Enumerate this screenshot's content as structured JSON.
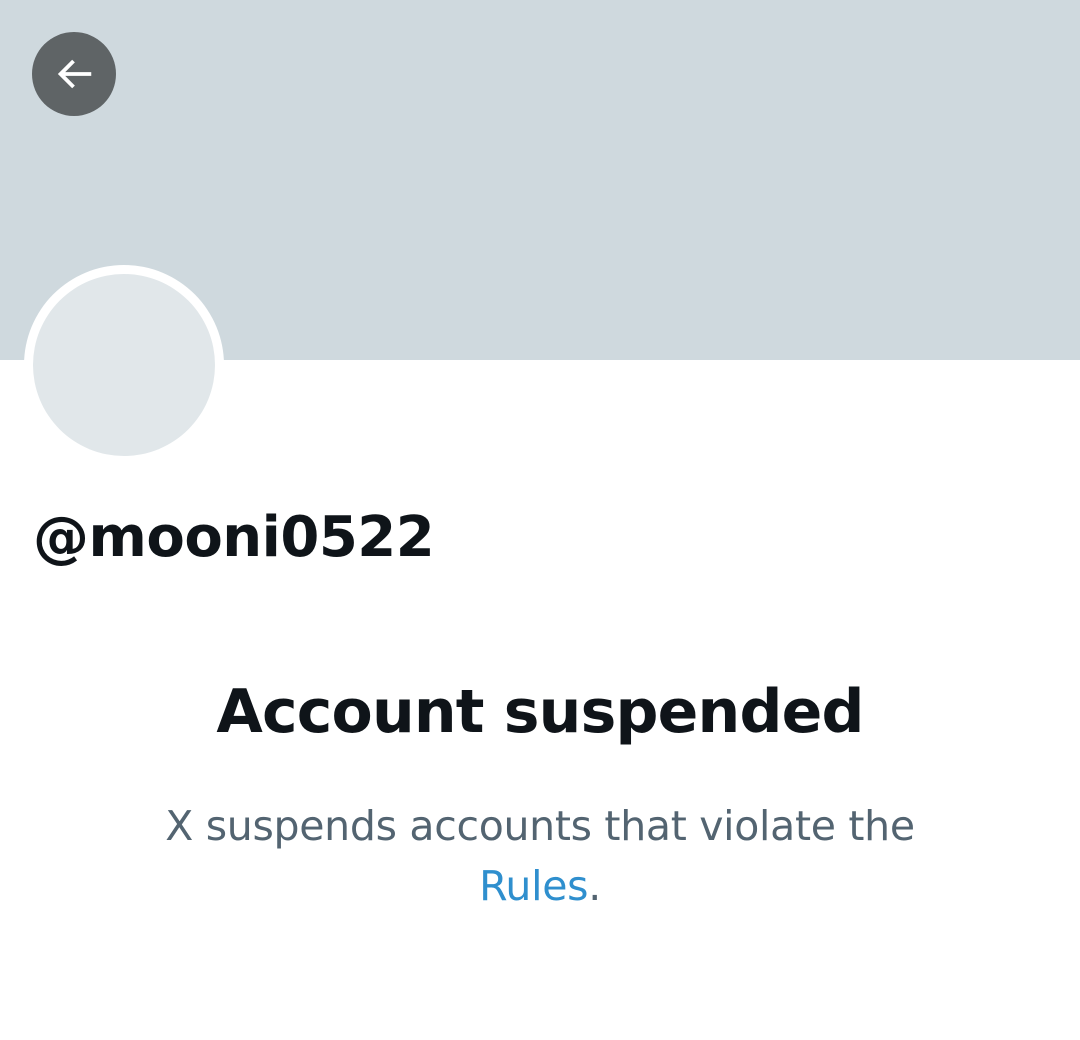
{
  "profile": {
    "handle": "@mooni0522",
    "back_icon": "arrow-left-icon"
  },
  "suspension": {
    "title": "Account suspended",
    "message_prefix": "X suspends accounts that violate the",
    "rules_link": "Rules",
    "message_suffix": "."
  },
  "colors": {
    "banner": "#cfd9de",
    "avatar_placeholder": "#e1e7ea",
    "back_button": "#5f6466",
    "text_primary": "#0f1419",
    "text_secondary": "#536471",
    "link": "#2f8fce"
  }
}
